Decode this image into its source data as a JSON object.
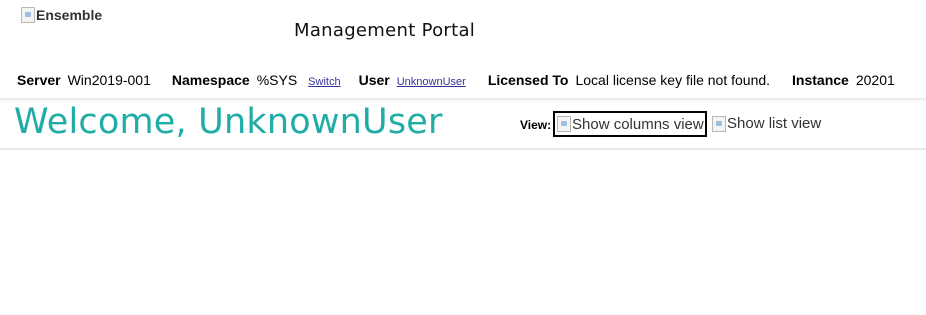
{
  "header": {
    "logo_alt": "Ensemble",
    "portal_title": "Management Portal"
  },
  "info_bar": {
    "server_label": "Server",
    "server_value": "Win2019-001",
    "namespace_label": "Namespace",
    "namespace_value": "%SYS",
    "switch_link": "Switch",
    "user_label": "User",
    "user_link": "UnknownUser",
    "licensed_label": "Licensed To",
    "licensed_value": "Local license key file not found.",
    "instance_label": "Instance",
    "instance_value": "20201"
  },
  "main": {
    "welcome": "Welcome, UnknownUser",
    "view_label": "View:",
    "columns_view_alt": "Show columns view",
    "list_view_alt": "Show list view"
  },
  "colors": {
    "accent": "#1fada6",
    "link": "#333399"
  },
  "icons": {
    "logo": "broken-image-icon",
    "columns_view": "broken-image-icon",
    "list_view": "broken-image-icon"
  }
}
